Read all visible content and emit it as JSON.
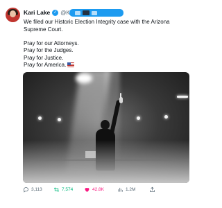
{
  "author": {
    "name": "Kari Lake",
    "handle": "@KariLa"
  },
  "tweet": {
    "lines_1": [
      "We filed our Historic Election Integrity case with the Arizona Supreme Court."
    ],
    "lines_2": [
      "Pray for our Attorneys.",
      "Pray for the Judges.",
      "Pray for Justice.",
      "Pray for America."
    ]
  },
  "image": {
    "description_icon": "stage-photo-icon"
  },
  "actions": {
    "replies": "3,113",
    "retweets": "7,574",
    "likes": "42.8K",
    "views": "1.2M"
  },
  "colors": {
    "verified": "#1d9bf0",
    "retweet_active": "#00ba7c",
    "like_active": "#f91880",
    "secondary_text": "#536471"
  }
}
